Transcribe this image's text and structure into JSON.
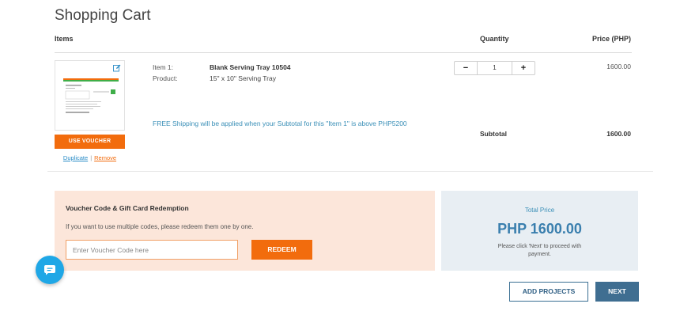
{
  "page": {
    "title": "Shopping Cart"
  },
  "table_header": {
    "items": "Items",
    "quantity": "Quantity",
    "price": "Price (PHP)"
  },
  "cart_item": {
    "item_label": "Item 1:",
    "item_name": "Blank Serving Tray 10504",
    "product_label": "Product:",
    "product_value": "15\" x 10\" Serving Tray",
    "quantity": "1",
    "decrement_label": "−",
    "increment_label": "+",
    "price": "1600.00",
    "shipping_note": "FREE Shipping will be applied when your Subtotal for this \"Item 1\" is above PHP5200",
    "subtotal_label": "Subtotal",
    "subtotal_value": "1600.00",
    "voucher_button": "USE VOUCHER",
    "duplicate_link": "Duplicate",
    "link_separator": "|",
    "remove_link": "Remove"
  },
  "voucher": {
    "title": "Voucher Code & Gift Card Redemption",
    "description": "If you want to use multiple codes, please redeem them one by one.",
    "placeholder": "Enter Voucher Code here",
    "redeem_button": "REDEEM"
  },
  "total": {
    "label": "Total Price",
    "amount": "PHP 1600.00",
    "note": "Please click 'Next' to proceed with payment."
  },
  "actions": {
    "add_projects": "ADD PROJECTS",
    "next": "NEXT"
  },
  "colors": {
    "accent_orange": "#f26c0d",
    "accent_blue": "#3f6e91",
    "link_blue": "#2a8cc7",
    "voucher_bg": "#fce6da",
    "total_bg": "#e8eef3",
    "chat_blue": "#1fa7e6"
  },
  "icons": {
    "edit": "edit-icon",
    "chat": "chat-icon"
  }
}
